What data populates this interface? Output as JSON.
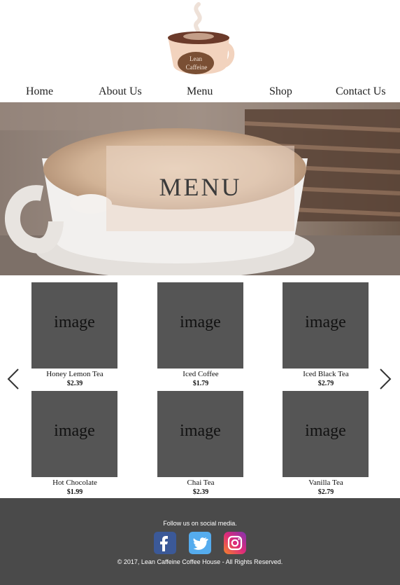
{
  "logo": {
    "text_line1": "Lean",
    "text_line2": "Caffeine",
    "icon": "coffee-cup-icon"
  },
  "nav": {
    "items": [
      {
        "label": "Home"
      },
      {
        "label": "About Us"
      },
      {
        "label": "Menu"
      },
      {
        "label": "Shop"
      },
      {
        "label": "Contact Us"
      }
    ]
  },
  "hero": {
    "title": "MENU"
  },
  "products": {
    "placeholder_text": "image",
    "items": [
      {
        "name": "Honey Lemon Tea",
        "price": "$2.39"
      },
      {
        "name": "Iced Coffee",
        "price": "$1.79"
      },
      {
        "name": "Iced Black Tea",
        "price": "$2.79"
      },
      {
        "name": "Hot Chocolate",
        "price": "$1.99"
      },
      {
        "name": "Chai Tea",
        "price": "$2.39"
      },
      {
        "name": "Vanilla Tea",
        "price": "$2.79"
      }
    ]
  },
  "carousel": {
    "prev_icon": "chevron-left-icon",
    "next_icon": "chevron-right-icon"
  },
  "footer": {
    "follow_text": "Follow us on social media.",
    "social": [
      {
        "icon": "facebook-icon",
        "color": "#3b5998"
      },
      {
        "icon": "twitter-icon",
        "color": "#55acee"
      },
      {
        "icon": "instagram-icon",
        "color": "#c13584"
      }
    ],
    "copyright": "© 2017, Lean Caffeine Coffee House - All Rights Reserved."
  },
  "colors": {
    "footer_bg": "#4a4a4a",
    "image_placeholder": "#555555",
    "cup_body": "#f2d3be",
    "cup_label": "#7a4f34"
  }
}
